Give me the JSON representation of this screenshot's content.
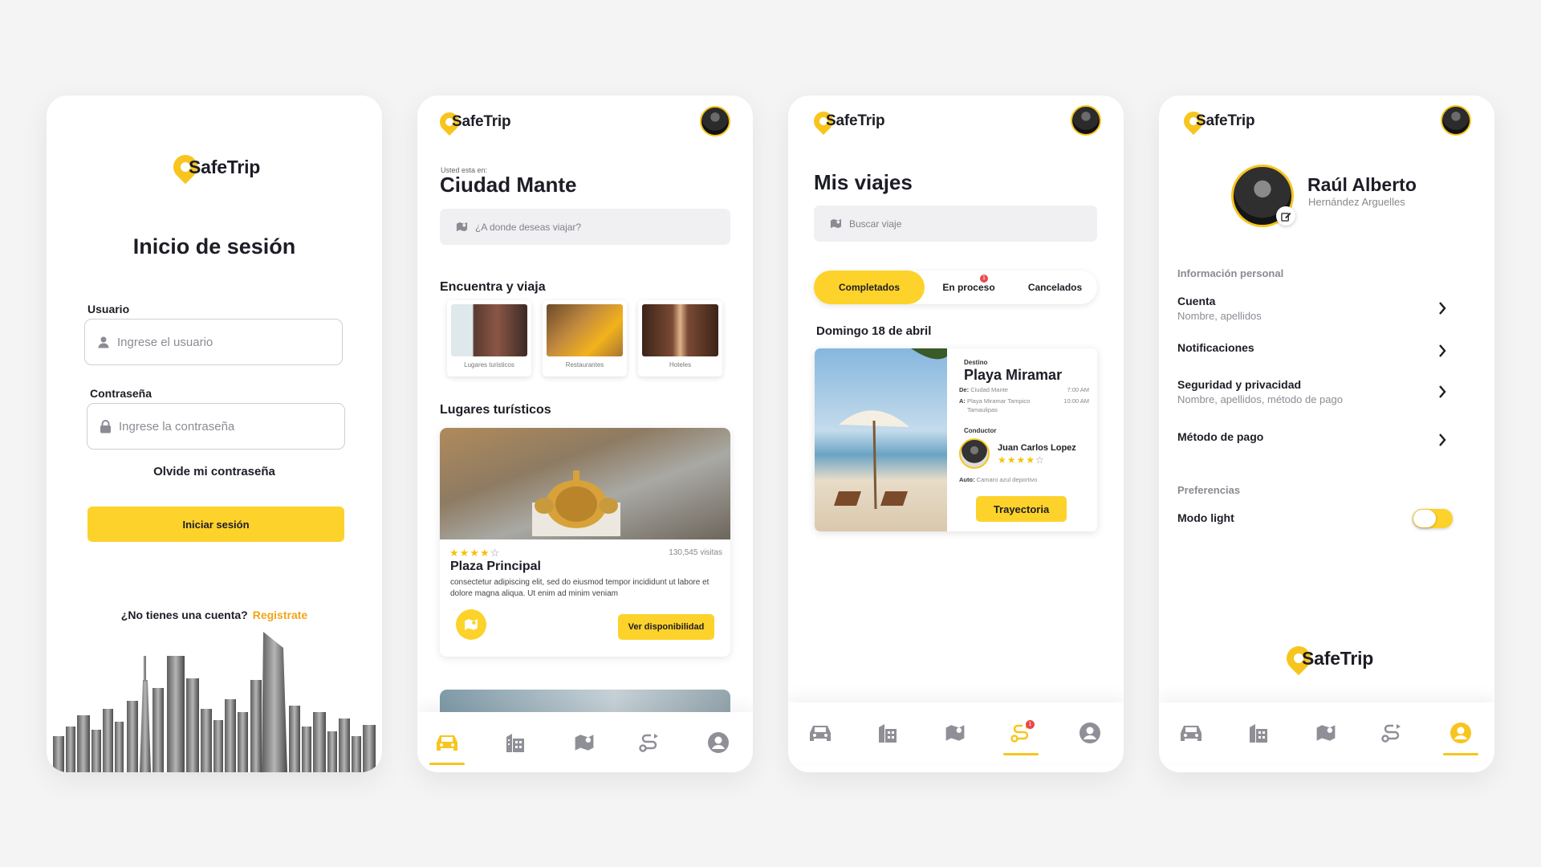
{
  "brand": {
    "name": "SafeTrip",
    "accent": "#fdd22a",
    "pin": "#f7c51e",
    "link": "#f2a516",
    "badge": "#e84a4a"
  },
  "login": {
    "title": "Inicio de sesión",
    "user_label": "Usuario",
    "user_placeholder": "Ingrese el usuario",
    "password_label": "Contraseña",
    "password_placeholder": "Ingrese la contraseña",
    "forgot": "Olvide mi contraseña",
    "submit": "Iniciar sesión",
    "no_account": "¿No tienes una cuenta?",
    "register": "Registrate"
  },
  "explore": {
    "location_label": "Usted esta en:",
    "city": "Ciudad Mante",
    "search_placeholder": "¿A donde deseas viajar?",
    "categories_title": "Encuentra y viaja",
    "categories": [
      "Lugares turisticos",
      "Restaurantes",
      "Hoteles"
    ],
    "places_title": "Lugares turísticos",
    "place": {
      "rating": 4,
      "visits": "130,545 visitas",
      "name": "Plaza Principal",
      "description": "consectetur adipiscing elit, sed do eiusmod tempor incididunt ut labore et dolore magna aliqua. Ut enim ad minim veniam",
      "cta": "Ver disponibilidad"
    }
  },
  "trips": {
    "title": "Mis viajes",
    "search_placeholder": "Buscar viaje",
    "tabs": [
      {
        "label": "Completados",
        "active": true
      },
      {
        "label": "En proceso",
        "badge": "1"
      },
      {
        "label": "Cancelados"
      }
    ],
    "date": "Domingo 18 de abril",
    "trip": {
      "dest_label": "Destino",
      "destination": "Playa Miramar",
      "from_label": "De:",
      "from": "Ciudad Mante",
      "from_time": "7:00 AM",
      "to_label": "A:",
      "to_line1": "Playa Miramar Tampico",
      "to_line2": "Tamaulipas",
      "to_time": "10:00 AM",
      "driver_label": "Conductor",
      "driver": "Juan Carlos Lopez",
      "driver_rating": 4,
      "car_label": "Auto:",
      "car": "Camaro azul deportivo",
      "cta": "Trayectoria"
    }
  },
  "profile": {
    "first_name": "Raúl Alberto",
    "last_name": "Hernández Arguelles",
    "personal_title": "Información personal",
    "rows": [
      {
        "title": "Cuenta",
        "sub": "Nombre, apellidos"
      },
      {
        "title": "Notificaciones",
        "sub": ""
      },
      {
        "title": "Seguridad y privacidad",
        "sub": "Nombre, apellidos, método de pago"
      },
      {
        "title": "Método de pago",
        "sub": ""
      }
    ],
    "prefs_title": "Preferencias",
    "light_mode_label": "Modo light",
    "light_mode_on": true
  },
  "nav": {
    "icons": [
      "car-icon",
      "building-icon",
      "map-icon",
      "route-icon",
      "user-icon"
    ],
    "route_badge": "1"
  }
}
